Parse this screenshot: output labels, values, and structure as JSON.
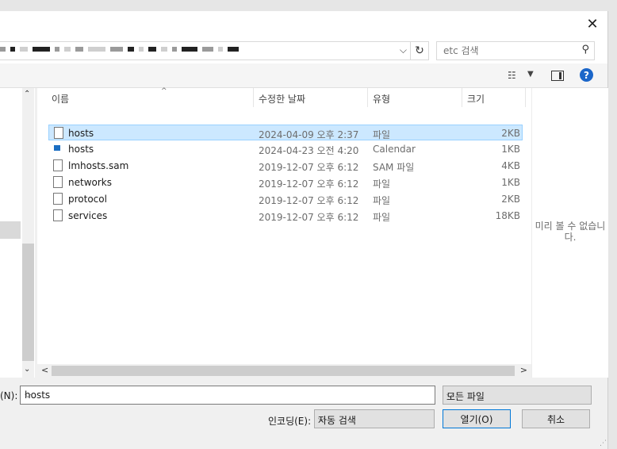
{
  "search": {
    "placeholder": "etc 검색"
  },
  "columns": {
    "name": "이름",
    "date": "수정한 날짜",
    "type": "유형",
    "size": "크기"
  },
  "files": [
    {
      "name": "hosts",
      "date": "2024-04-09 오후 2:37",
      "type": "파일",
      "size": "2KB",
      "icon": "file-icon",
      "selected": true
    },
    {
      "name": "hosts",
      "date": "2024-04-23 오전 4:20",
      "type": "Calendar",
      "size": "1KB",
      "icon": "calendar-file-icon"
    },
    {
      "name": "lmhosts.sam",
      "date": "2019-12-07 오후 6:12",
      "type": "SAM 파일",
      "size": "4KB",
      "icon": "file-icon"
    },
    {
      "name": "networks",
      "date": "2019-12-07 오후 6:12",
      "type": "파일",
      "size": "1KB",
      "icon": "file-icon"
    },
    {
      "name": "protocol",
      "date": "2019-12-07 오후 6:12",
      "type": "파일",
      "size": "2KB",
      "icon": "file-icon"
    },
    {
      "name": "services",
      "date": "2019-12-07 오후 6:12",
      "type": "파일",
      "size": "18KB",
      "icon": "file-icon"
    }
  ],
  "preview": {
    "message": "미리 볼 수 없습니다."
  },
  "bottom": {
    "filename_label": "(N):",
    "filename_value": "hosts",
    "filetype_value": "모든 파일",
    "encoding_label": "인코딩(E):",
    "encoding_value": "자동 검색",
    "open_label": "열기(O)",
    "cancel_label": "취소"
  },
  "colors": {
    "selection": "#cce8ff",
    "accent": "#0078d7",
    "help": "#1b66c9"
  }
}
